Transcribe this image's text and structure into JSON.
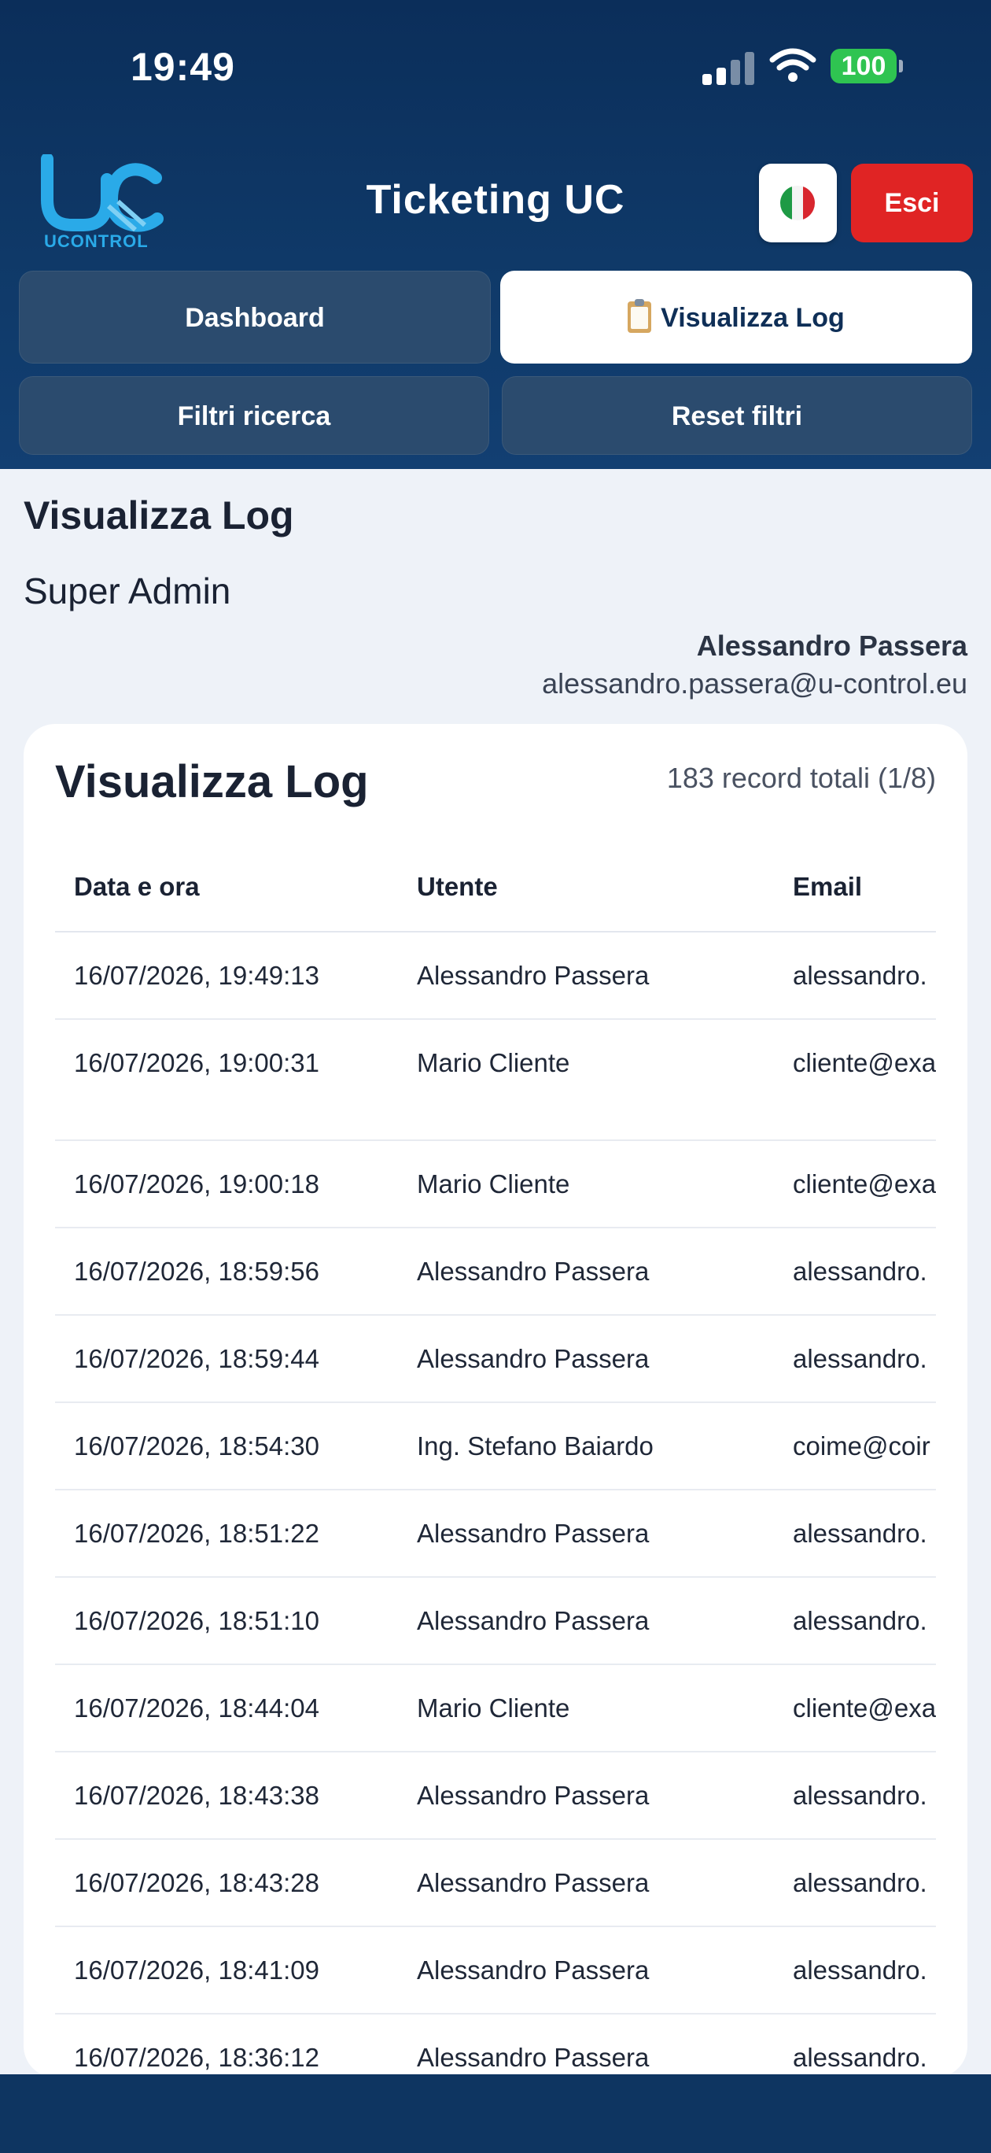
{
  "status_bar": {
    "time": "19:49",
    "battery": "100"
  },
  "header": {
    "logo_text": "UCONTROL",
    "title": "Ticketing UC",
    "language_flag": "italian-flag",
    "logout_label": "Esci"
  },
  "nav": {
    "dashboard": "Dashboard",
    "view_log": "Visualizza Log",
    "search_filters": "Filtri ricerca",
    "reset_filters": "Reset filtri"
  },
  "page": {
    "title": "Visualizza Log",
    "role": "Super Admin",
    "user_name": "Alessandro Passera",
    "user_email": "alessandro.passera@u-control.eu"
  },
  "log_card": {
    "title": "Visualizza Log",
    "count": "183 record totali (1/8)",
    "columns": [
      "Data e ora",
      "Utente",
      "Email"
    ],
    "rows": [
      [
        "16/07/2026, 19:49:13",
        "Alessandro Passera",
        "alessandro."
      ],
      [
        "16/07/2026, 19:00:31",
        "Mario Cliente",
        "cliente@exa"
      ],
      [
        "16/07/2026, 19:00:18",
        "Mario Cliente",
        "cliente@exa"
      ],
      [
        "16/07/2026, 18:59:56",
        "Alessandro Passera",
        "alessandro."
      ],
      [
        "16/07/2026, 18:59:44",
        "Alessandro Passera",
        "alessandro."
      ],
      [
        "16/07/2026, 18:54:30",
        "Ing. Stefano Baiardo",
        "coime@coir"
      ],
      [
        "16/07/2026, 18:51:22",
        "Alessandro Passera",
        "alessandro."
      ],
      [
        "16/07/2026, 18:51:10",
        "Alessandro Passera",
        "alessandro."
      ],
      [
        "16/07/2026, 18:44:04",
        "Mario Cliente",
        "cliente@exa"
      ],
      [
        "16/07/2026, 18:43:38",
        "Alessandro Passera",
        "alessandro."
      ],
      [
        "16/07/2026, 18:43:28",
        "Alessandro Passera",
        "alessandro."
      ],
      [
        "16/07/2026, 18:41:09",
        "Alessandro Passera",
        "alessandro."
      ],
      [
        "16/07/2026, 18:36:12",
        "Alessandro Passera",
        "alessandro."
      ]
    ]
  },
  "colors": {
    "header": "#0f3968",
    "danger": "#e02424",
    "battery": "#2fc451",
    "accent": "#2aaae8"
  }
}
